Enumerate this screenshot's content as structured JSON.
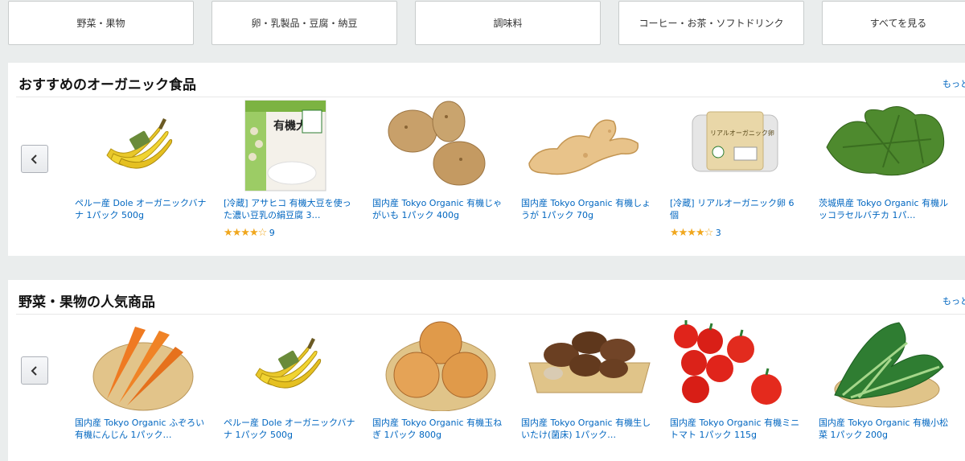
{
  "categories": [
    {
      "label": "野菜・果物"
    },
    {
      "label": "卵・乳製品・豆腐・納豆"
    },
    {
      "label": "調味料"
    },
    {
      "label": "コーヒー・お茶・ソフトドリンク"
    },
    {
      "label": "すべてを見る"
    }
  ],
  "section1": {
    "title": "おすすめのオーガニック食品",
    "see_more": "もっと見る",
    "items": [
      {
        "name": "ペルー産 Dole オーガニックバナナ 1パック 500g",
        "image": "banana-image"
      },
      {
        "name": "[冷蔵] アサヒコ 有機大豆を使った濃い豆乳の絹豆腐 3…",
        "image": "tofu-image",
        "stars": "★★★★☆",
        "reviews": "9"
      },
      {
        "name": "国内産 Tokyo Organic 有機じゃがいも 1パック 400g",
        "image": "potato-image"
      },
      {
        "name": "国内産 Tokyo Organic 有機しょうが 1パック 70g",
        "image": "ginger-image"
      },
      {
        "name": "[冷蔵] リアルオーガニック卵 6個",
        "image": "egg-carton-image",
        "stars": "★★★★☆",
        "reviews": "3"
      },
      {
        "name": "茨城県産 Tokyo Organic 有機ルッコラセルバチカ 1パ…",
        "image": "arugula-image"
      }
    ]
  },
  "section2": {
    "title": "野菜・果物の人気商品",
    "see_more": "もっと見る",
    "items": [
      {
        "name": "国内産 Tokyo Organic ふぞろい有機にんじん 1パック…",
        "image": "carrot-image"
      },
      {
        "name": "ペルー産 Dole オーガニックバナナ 1パック 500g",
        "image": "banana-image"
      },
      {
        "name": "国内産 Tokyo Organic 有機玉ねぎ 1パック 800g",
        "image": "onion-image"
      },
      {
        "name": "国内産 Tokyo Organic 有機生しいたけ(菌床) 1パック…",
        "image": "shiitake-image"
      },
      {
        "name": "国内産 Tokyo Organic 有機ミニトマト 1パック 115g",
        "image": "tomato-image"
      },
      {
        "name": "国内産 Tokyo Organic 有機小松菜 1パック 200g",
        "image": "komatsuna-image"
      }
    ]
  },
  "tofu_package_text": "有機大豆",
  "egg_package_text": "リアルオーガニック卵"
}
